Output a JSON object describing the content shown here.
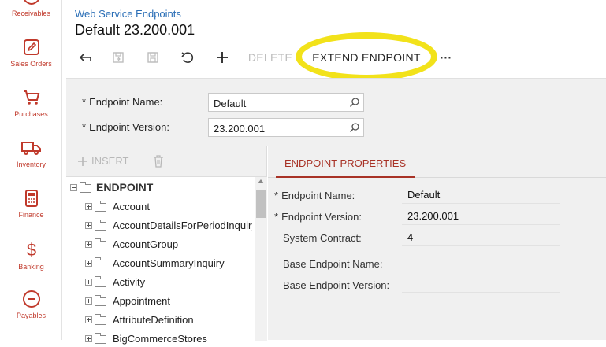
{
  "sidebar": {
    "items": [
      {
        "label": "Receivables",
        "icon": "receivables-icon"
      },
      {
        "label": "Sales Orders",
        "icon": "sales-orders-icon"
      },
      {
        "label": "Purchases",
        "icon": "cart-icon"
      },
      {
        "label": "Inventory",
        "icon": "truck-icon"
      },
      {
        "label": "Finance",
        "icon": "calculator-icon"
      },
      {
        "label": "Banking",
        "icon": "dollar-icon"
      },
      {
        "label": "Payables",
        "icon": "minus-circle-icon"
      }
    ]
  },
  "header": {
    "breadcrumb": "Web Service Endpoints",
    "title": "Default 23.200.001"
  },
  "toolbar": {
    "delete_label": "DELETE",
    "extend_label": "EXTEND ENDPOINT",
    "more_label": "···"
  },
  "form": {
    "endpoint_name_label": "Endpoint Name:",
    "endpoint_name_value": "Default",
    "endpoint_version_label": "Endpoint Version:",
    "endpoint_version_value": "23.200.001"
  },
  "tree": {
    "insert_label": "INSERT",
    "root": "ENDPOINT",
    "items": [
      "Account",
      "AccountDetailsForPeriodInquiry",
      "AccountGroup",
      "AccountSummaryInquiry",
      "Activity",
      "Appointment",
      "AttributeDefinition",
      "BigCommerceStores"
    ]
  },
  "properties": {
    "tab_label": "ENDPOINT PROPERTIES",
    "rows": [
      {
        "label": "Endpoint Name:",
        "value": "Default",
        "required": true
      },
      {
        "label": "Endpoint Version:",
        "value": "23.200.001",
        "required": true
      },
      {
        "label": "System Contract:",
        "value": "4",
        "required": false
      },
      {
        "label": "Base Endpoint Name:",
        "value": "",
        "required": false
      },
      {
        "label": "Base Endpoint Version:",
        "value": "",
        "required": false
      }
    ]
  },
  "colors": {
    "accent": "#c0392b",
    "link": "#2a6eb6",
    "highlight": "#f2e21a"
  }
}
